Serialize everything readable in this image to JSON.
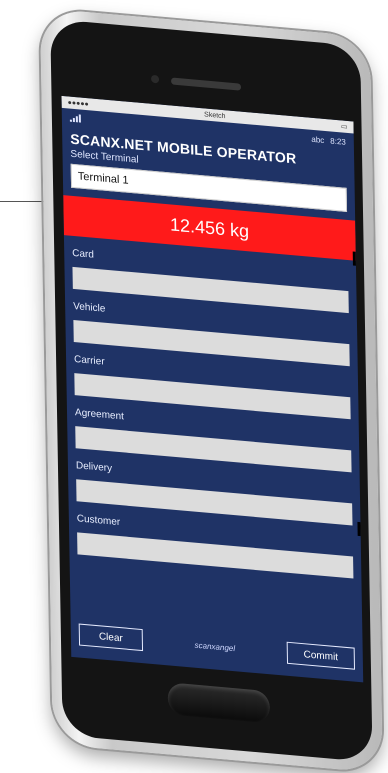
{
  "ios_status": {
    "left": "●●●●●",
    "center": "Sketch",
    "right": ""
  },
  "wp_status": {
    "signal": "",
    "right_label": "abc",
    "time": "8:23"
  },
  "app": {
    "title": "SCANX.NET MOBILE OPERATOR",
    "select_label": "Select Terminal",
    "terminal_value": "Terminal 1",
    "weight_display": "12.456 kg"
  },
  "fields": [
    {
      "label": "Card",
      "value": ""
    },
    {
      "label": "Vehicle",
      "value": ""
    },
    {
      "label": "Carrier",
      "value": ""
    },
    {
      "label": "Agreement",
      "value": ""
    },
    {
      "label": "Delivery",
      "value": ""
    },
    {
      "label": "Customer",
      "value": ""
    }
  ],
  "bottom": {
    "clear_label": "Clear",
    "logo_text": "scanxangel",
    "commit_label": "Commit"
  },
  "colors": {
    "screen_bg": "#1f3366",
    "weight_bg": "#ff1a1a",
    "input_bg": "#dcdcdc"
  }
}
